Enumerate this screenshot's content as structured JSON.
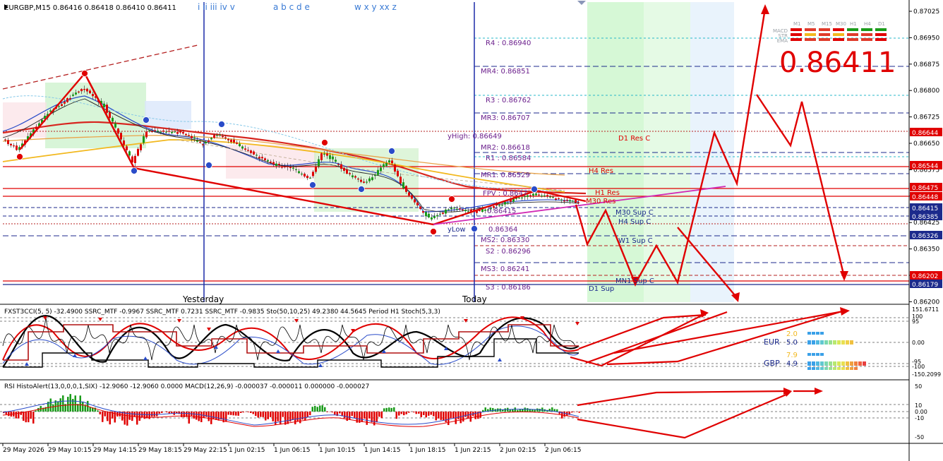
{
  "header": {
    "symbol_line": "EURGBP,M15  0.86416 0.86418 0.86410 0.86411",
    "wave_labels": [
      "i ii iii iv v",
      "a b c d e",
      "w x y xx z"
    ]
  },
  "big_price": "0.86411",
  "tf_panel": {
    "timeframes": [
      "M1",
      "M5",
      "M15",
      "M30",
      "H1",
      "H4",
      "D1"
    ],
    "rows": [
      "MACD",
      "STR",
      "EMA"
    ]
  },
  "day_labels": {
    "yesterday": "Yesterday",
    "today": "Today"
  },
  "levels": [
    {
      "label": "R4 : 0.86940"
    },
    {
      "label": "MR4: 0.86851"
    },
    {
      "label": "R3 : 0.86762"
    },
    {
      "label": "MR3: 0.86707"
    },
    {
      "label": "yHigh: 0.86649"
    },
    {
      "label": "MR2: 0.86618"
    },
    {
      "label": "R1 : 0.86584"
    },
    {
      "label": "MR1: 0.86529"
    },
    {
      "label": "FPV : 0.8647"
    },
    {
      "label": "0.86415"
    },
    {
      "label": "yLow"
    },
    {
      "label": "0.86364"
    },
    {
      "label": "MS2: 0.86330"
    },
    {
      "label": "S2 : 0.86296"
    },
    {
      "label": "MS3: 0.86241"
    },
    {
      "label": "S3 : 0.86186"
    }
  ],
  "zone_labels": [
    {
      "text": "D1 Res C"
    },
    {
      "text": "H4 Res"
    },
    {
      "text": "H1 Res"
    },
    {
      "text": "M30 Res"
    },
    {
      "text": "M30 Sup C"
    },
    {
      "text": "H4 Sup C"
    },
    {
      "text": "W1 Sup C"
    },
    {
      "text": "MN1 Sup C"
    },
    {
      "text": "D1 Sup"
    }
  ],
  "price_axis": {
    "ticks": [
      "0.87025",
      "0.86950",
      "0.86875",
      "0.86800",
      "0.86725",
      "0.86650",
      "0.86575",
      "0.86500",
      "0.86425",
      "0.86350",
      "0.86275",
      "0.86200"
    ],
    "tags": [
      {
        "text": "0.86644",
        "color": "#e00000"
      },
      {
        "text": "0.86544",
        "color": "#e00000"
      },
      {
        "text": "0.86475",
        "color": "#e00000"
      },
      {
        "text": "0.86448",
        "color": "#e00000"
      },
      {
        "text": "0.86415",
        "color": "#1c2a8c"
      },
      {
        "text": "0.86385",
        "color": "#1c2a8c"
      },
      {
        "text": "0.86326",
        "color": "#1c2a8c"
      },
      {
        "text": "0.86202",
        "color": "#e00000"
      },
      {
        "text": "0.86179",
        "color": "#1c2a8c"
      }
    ]
  },
  "panel1": {
    "title": "FXST3CCI(5, 5) -32.4900  SSRC_MTF -0.9967  SSRC_MTF 0.7231  SSRC_MTF -0.9835  Sto(50,10,25) 49.2380 44.5645  Period H1 Stoch(5,3,3)",
    "axis": [
      "151.6711",
      "100",
      "95",
      "0.00",
      "-95",
      "-100",
      "-150.2099"
    ],
    "currencies": [
      {
        "name": "EUR",
        "value": "5.0",
        "pre": "2.0"
      },
      {
        "name": "GBP",
        "value": "4.9",
        "pre": "7.9"
      }
    ]
  },
  "panel2": {
    "title": "RSI HistoAlert(13,0,0,0,1,SIX) -12.9060 -12.9060 0.0000  MACD(12,26,9) -0.000037 -0.000011 0.000000 -0.000027",
    "axis": [
      "50",
      "10",
      "0.00",
      "-10",
      "-50"
    ]
  },
  "time_axis": [
    "29 May 2026",
    "29 May 10:15",
    "29 May 14:15",
    "29 May 18:15",
    "29 May 22:15",
    "1 Jun 02:15",
    "1 Jun 06:15",
    "1 Jun 10:15",
    "1 Jun 14:15",
    "1 Jun 18:15",
    "1 Jun 22:15",
    "2 Jun 02:15",
    "2 Jun 06:15"
  ],
  "colors": {
    "bull": "#1a9b1a",
    "bear": "#e00000",
    "blue": "#1c2a8c",
    "arrow": "#e00000"
  }
}
